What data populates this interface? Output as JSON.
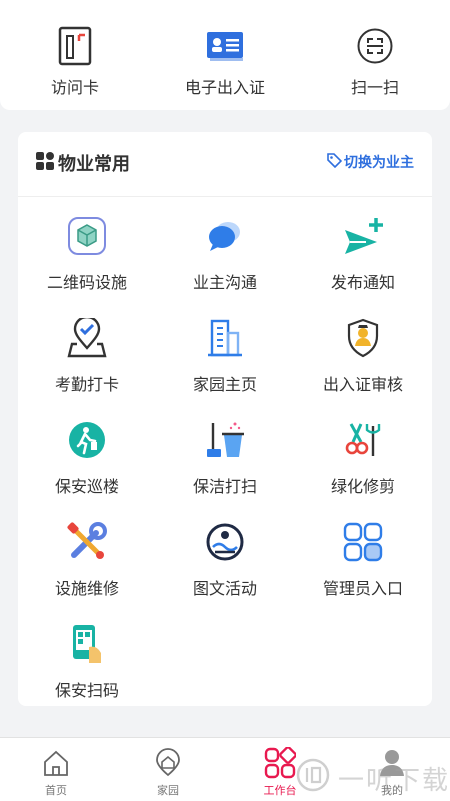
{
  "quick_actions": [
    {
      "label": "访问卡",
      "icon": "access-card-icon"
    },
    {
      "label": "电子出入证",
      "icon": "e-pass-icon"
    },
    {
      "label": "扫一扫",
      "icon": "scan-icon"
    }
  ],
  "card": {
    "title": "物业常用",
    "switch_label": "切换为业主",
    "items": [
      {
        "label": "二维码设施",
        "icon": "qr-facility-icon"
      },
      {
        "label": "业主沟通",
        "icon": "chat-icon"
      },
      {
        "label": "发布通知",
        "icon": "send-notice-icon"
      },
      {
        "label": "考勤打卡",
        "icon": "attendance-icon"
      },
      {
        "label": "家园主页",
        "icon": "building-icon"
      },
      {
        "label": "出入证审核",
        "icon": "pass-review-icon"
      },
      {
        "label": "保安巡楼",
        "icon": "patrol-icon"
      },
      {
        "label": "保洁打扫",
        "icon": "cleaning-icon"
      },
      {
        "label": "绿化修剪",
        "icon": "pruning-icon"
      },
      {
        "label": "设施维修",
        "icon": "repair-tools-icon"
      },
      {
        "label": "图文活动",
        "icon": "photo-activity-icon"
      },
      {
        "label": "管理员入口",
        "icon": "admin-grid-icon"
      },
      {
        "label": "保安扫码",
        "icon": "security-scan-icon"
      }
    ]
  },
  "tabbar": [
    {
      "label": "首页",
      "icon": "home-icon",
      "active": false
    },
    {
      "label": "家园",
      "icon": "community-icon",
      "active": false
    },
    {
      "label": "工作台",
      "icon": "workbench-icon",
      "active": true
    },
    {
      "label": "我的",
      "icon": "profile-icon",
      "active": false
    }
  ],
  "watermark": "一听下载",
  "colors": {
    "accent": "#2f6fde",
    "active_tab": "#e8194f",
    "teal": "#18b3a4"
  }
}
